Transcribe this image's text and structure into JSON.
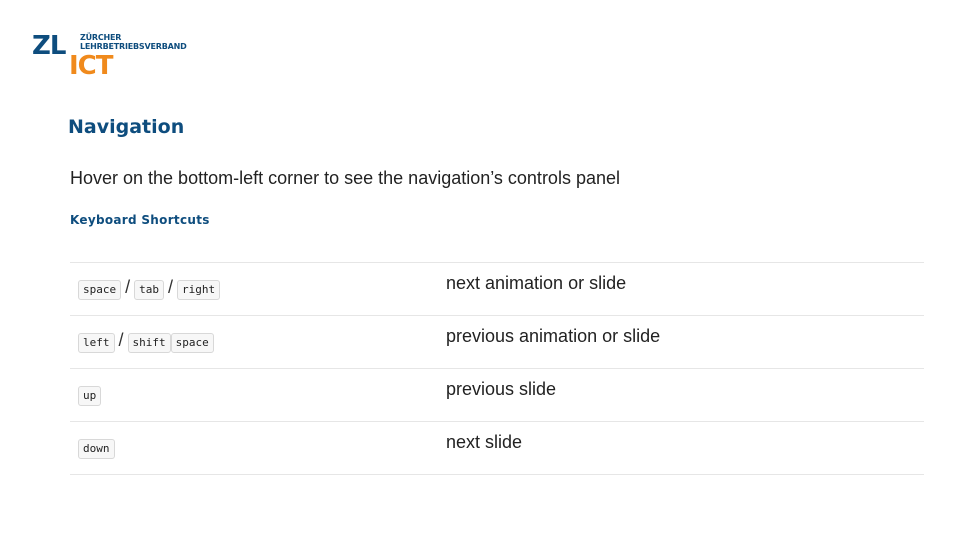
{
  "logo": {
    "primary": "ZL",
    "secondary": "ICT",
    "org_line1": "ZÜRCHER",
    "org_line2": "LEHRBETRIEBSVERBAND",
    "colors": {
      "blue": "#0e4d7e",
      "orange": "#f08a1c"
    }
  },
  "slide": {
    "title": "Navigation",
    "intro": "Hover on the bottom-left corner to see the navigation’s controls panel",
    "subtitle": "Keyboard Shortcuts"
  },
  "shortcuts": {
    "rows": [
      {
        "keys": [
          "space",
          "tab",
          "right"
        ],
        "separators": [
          "/",
          "/"
        ],
        "description": "next animation or slide"
      },
      {
        "keys": [
          "left",
          "shift",
          "space"
        ],
        "separators": [
          "/",
          ""
        ],
        "description": "previous animation or slide"
      },
      {
        "keys": [
          "up"
        ],
        "separators": [],
        "description": "previous slide"
      },
      {
        "keys": [
          "down"
        ],
        "separators": [],
        "description": "next slide"
      }
    ]
  }
}
